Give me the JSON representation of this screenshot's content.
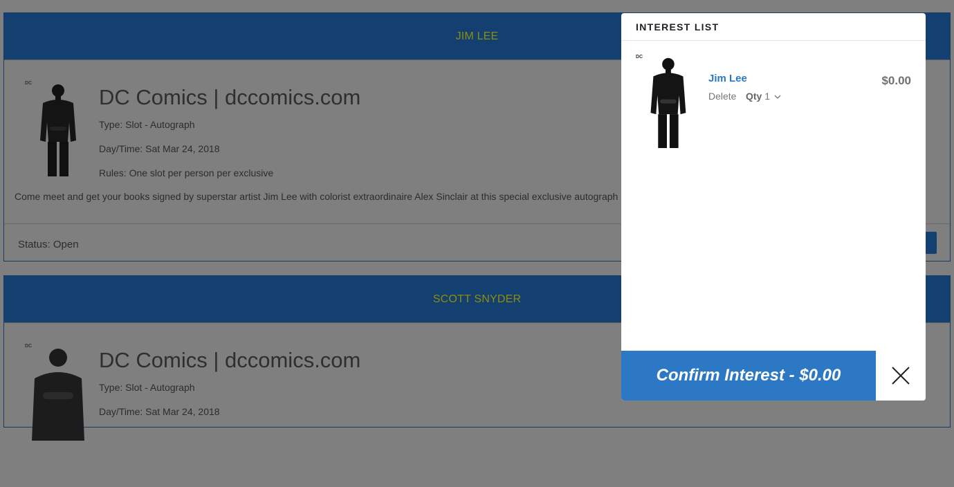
{
  "events": [
    {
      "artist": "JIM LEE",
      "vendor": "DC Comics | dccomics.com",
      "type": "Type: Slot - Autograph",
      "day_time": "Day/Time: Sat Mar 24, 2018",
      "rules": "Rules: One slot per person per exclusive",
      "description": "Come meet and get your books signed by superstar artist Jim Lee with colorist extraordinaire Alex Sinclair at this special exclusive autograph",
      "status": "Status: Open",
      "logo_text": "DC"
    },
    {
      "artist": "SCOTT SNYDER",
      "vendor": "DC Comics | dccomics.com",
      "type": "Type: Slot - Autograph",
      "day_time": "Day/Time: Sat Mar 24, 2018",
      "logo_text": "DC"
    }
  ],
  "interest_list": {
    "title": "INTEREST LIST",
    "items": [
      {
        "name": "Jim Lee",
        "delete_label": "Delete",
        "qty_label": "Qty",
        "qty_value": "1",
        "price": "$0.00",
        "logo_text": "DC"
      }
    ],
    "confirm_label": "Confirm Interest - $0.00"
  },
  "colors": {
    "header_bg": "#134070",
    "header_text": "#8e8d0d",
    "accent": "#2c78c4",
    "overlay": "#7f7f7f"
  }
}
